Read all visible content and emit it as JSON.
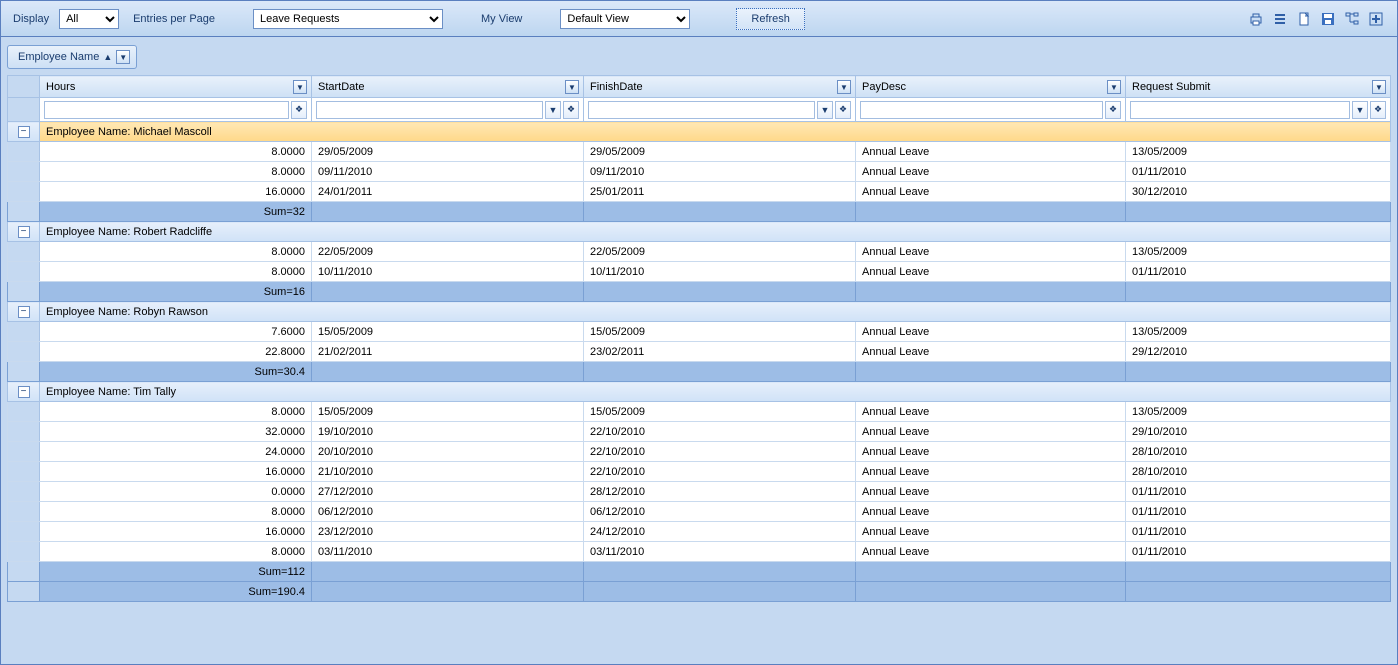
{
  "toolbar": {
    "display_label": "Display",
    "display_value": "All",
    "entries_label": "Entries per Page",
    "filter_value": "Leave Requests",
    "myview_label": "My View",
    "myview_value": "Default View",
    "refresh_label": "Refresh"
  },
  "group_by": {
    "field": "Employee Name"
  },
  "columns": {
    "hours": "Hours",
    "start": "StartDate",
    "finish": "FinishDate",
    "pay": "PayDesc",
    "req": "Request Submit"
  },
  "groups": [
    {
      "label_prefix": "Employee Name:",
      "name": "Michael Mascoll",
      "selected": true,
      "rows": [
        {
          "hours": "8.0000",
          "start": "29/05/2009",
          "finish": "29/05/2009",
          "pay": "Annual Leave",
          "req": "13/05/2009"
        },
        {
          "hours": "8.0000",
          "start": "09/11/2010",
          "finish": "09/11/2010",
          "pay": "Annual Leave",
          "req": "01/11/2010"
        },
        {
          "hours": "16.0000",
          "start": "24/01/2011",
          "finish": "25/01/2011",
          "pay": "Annual Leave",
          "req": "30/12/2010"
        }
      ],
      "sum": "Sum=32"
    },
    {
      "label_prefix": "Employee Name:",
      "name": "Robert Radcliffe",
      "selected": false,
      "rows": [
        {
          "hours": "8.0000",
          "start": "22/05/2009",
          "finish": "22/05/2009",
          "pay": "Annual Leave",
          "req": "13/05/2009"
        },
        {
          "hours": "8.0000",
          "start": "10/11/2010",
          "finish": "10/11/2010",
          "pay": "Annual Leave",
          "req": "01/11/2010"
        }
      ],
      "sum": "Sum=16"
    },
    {
      "label_prefix": "Employee Name:",
      "name": "Robyn Rawson",
      "selected": false,
      "rows": [
        {
          "hours": "7.6000",
          "start": "15/05/2009",
          "finish": "15/05/2009",
          "pay": "Annual Leave",
          "req": "13/05/2009"
        },
        {
          "hours": "22.8000",
          "start": "21/02/2011",
          "finish": "23/02/2011",
          "pay": "Annual Leave",
          "req": "29/12/2010"
        }
      ],
      "sum": "Sum=30.4"
    },
    {
      "label_prefix": "Employee Name:",
      "name": "Tim Tally",
      "selected": false,
      "rows": [
        {
          "hours": "8.0000",
          "start": "15/05/2009",
          "finish": "15/05/2009",
          "pay": "Annual Leave",
          "req": "13/05/2009"
        },
        {
          "hours": "32.0000",
          "start": "19/10/2010",
          "finish": "22/10/2010",
          "pay": "Annual Leave",
          "req": "29/10/2010"
        },
        {
          "hours": "24.0000",
          "start": "20/10/2010",
          "finish": "22/10/2010",
          "pay": "Annual Leave",
          "req": "28/10/2010"
        },
        {
          "hours": "16.0000",
          "start": "21/10/2010",
          "finish": "22/10/2010",
          "pay": "Annual Leave",
          "req": "28/10/2010"
        },
        {
          "hours": "0.0000",
          "start": "27/12/2010",
          "finish": "28/12/2010",
          "pay": "Annual Leave",
          "req": "01/11/2010"
        },
        {
          "hours": "8.0000",
          "start": "06/12/2010",
          "finish": "06/12/2010",
          "pay": "Annual Leave",
          "req": "01/11/2010"
        },
        {
          "hours": "16.0000",
          "start": "23/12/2010",
          "finish": "24/12/2010",
          "pay": "Annual Leave",
          "req": "01/11/2010"
        },
        {
          "hours": "8.0000",
          "start": "03/11/2010",
          "finish": "03/11/2010",
          "pay": "Annual Leave",
          "req": "01/11/2010"
        }
      ],
      "sum": "Sum=112"
    }
  ],
  "grand_sum": "Sum=190.4"
}
